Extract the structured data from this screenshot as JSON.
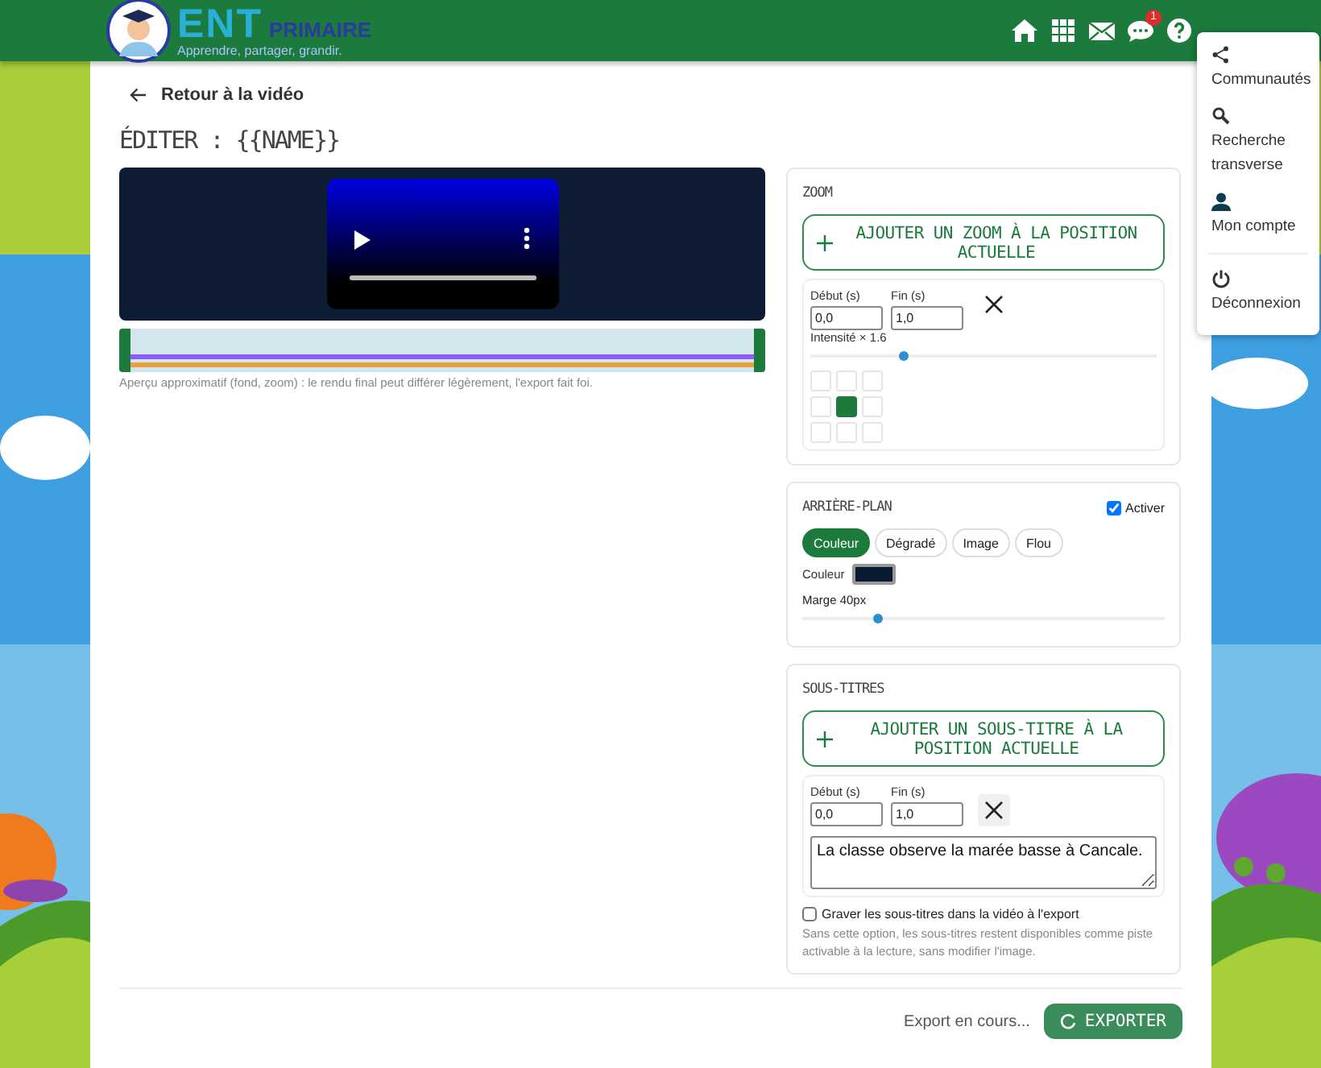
{
  "header": {
    "logo": {
      "ent": "ENT",
      "primaire": "PRIMAIRE",
      "tagline": "Apprendre, partager, grandir."
    },
    "nav_icons": [
      {
        "kind": "home"
      },
      {
        "kind": "apps"
      },
      {
        "kind": "mail"
      },
      {
        "kind": "chat",
        "badge": "1"
      },
      {
        "kind": "help"
      }
    ]
  },
  "user_menu": [
    {
      "kind": "share",
      "label": "Communautés"
    },
    {
      "kind": "search",
      "label": "Recherche transverse"
    },
    {
      "kind": "user",
      "label": "Mon compte"
    },
    {
      "kind": "power",
      "label": "Déconnexion",
      "separator_before": true
    }
  ],
  "back_link": "Retour à la vidéo",
  "title": "ÉDITER : {{NAME}}",
  "player": {
    "level": 1
  },
  "timeline": {
    "tracks": [
      {
        "color": "#8b5cf6"
      },
      {
        "color": "#e9a23b"
      }
    ]
  },
  "preview_note": "Aperçu approximatif (fond, zoom) : le rendu final peut différer légèrement, l'export fait foi.",
  "zoom": {
    "title": "ZOOM",
    "add_button": "AJOUTER UN ZOOM À LA POSITION ACTUELLE",
    "segment": {
      "start_label": "Début (s)",
      "start_value": "0,0",
      "end_label": "Fin (s)",
      "end_value": "1,0",
      "intensity": {
        "label": "Intensité × 1.6",
        "level": 0.27
      },
      "anchors": [
        {
          "selected": false
        },
        {
          "selected": false
        },
        {
          "selected": false
        },
        {
          "selected": false
        },
        {
          "selected": true
        },
        {
          "selected": false
        },
        {
          "selected": false
        },
        {
          "selected": false
        },
        {
          "selected": false
        }
      ]
    }
  },
  "background": {
    "title": "ARRIÈRE-PLAN",
    "enable": {
      "label": "Activer",
      "checked": true
    },
    "modes": [
      {
        "label": "Couleur",
        "selected": true
      },
      {
        "label": "Dégradé",
        "selected": false
      },
      {
        "label": "Image",
        "selected": false
      },
      {
        "label": "Flou",
        "selected": false
      }
    ],
    "color_label": "Couleur",
    "color": "#0b1a33",
    "margin": {
      "label": "Marge 40px",
      "level": 0.21
    }
  },
  "subtitles": {
    "title": "SOUS-TITRES",
    "add_button": "AJOUTER UN SOUS-TITRE À LA POSITION ACTUELLE",
    "segment": {
      "start_label": "Début (s)",
      "start_value": "0,0",
      "end_label": "Fin (s)",
      "end_value": "1,0",
      "text": "La classe observe la marée basse à Cancale."
    },
    "burn": {
      "label": "Graver les sous-titres dans la vidéo à l'export",
      "checked": false
    },
    "hint": "Sans cette option, les sous-titres restent disponibles comme piste activable à la lecture, sans modifier l'image."
  },
  "footer": {
    "status": "Export en cours...",
    "export_button": "EXPORTER"
  }
}
